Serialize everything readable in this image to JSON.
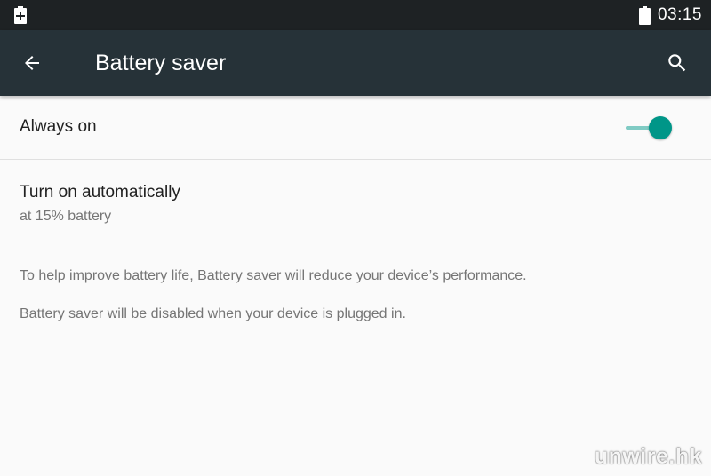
{
  "status_bar": {
    "time": "03:15",
    "left_icon": "battery-saver-plus-icon",
    "right_icon": "battery-icon"
  },
  "app_bar": {
    "title": "Battery saver",
    "back_icon": "back-arrow-icon",
    "search_icon": "search-icon"
  },
  "settings": {
    "always_on": {
      "label": "Always on",
      "enabled": true
    },
    "auto": {
      "title": "Turn on automatically",
      "summary": "at 15% battery"
    }
  },
  "footer": [
    "To help improve battery life, Battery saver will reduce your device’s performance.",
    "Battery saver will be disabled when your device is plugged in."
  ],
  "watermark": "unwire.hk",
  "colors": {
    "status_bar": "#1e2224",
    "app_bar": "#263238",
    "accent": "#009688",
    "background": "#fafafa"
  }
}
